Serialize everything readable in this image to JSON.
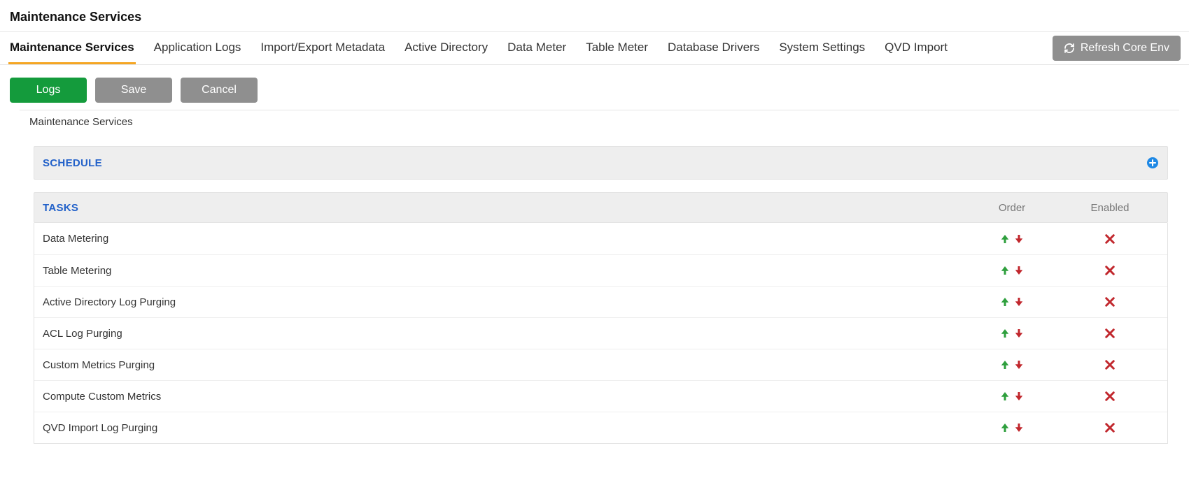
{
  "page": {
    "title": "Maintenance Services",
    "subtitle": "Maintenance Services"
  },
  "tabs": [
    {
      "label": "Maintenance Services",
      "active": true
    },
    {
      "label": "Application Logs",
      "active": false
    },
    {
      "label": "Import/Export Metadata",
      "active": false
    },
    {
      "label": "Active Directory",
      "active": false
    },
    {
      "label": "Data Meter",
      "active": false
    },
    {
      "label": "Table Meter",
      "active": false
    },
    {
      "label": "Database Drivers",
      "active": false
    },
    {
      "label": "System Settings",
      "active": false
    },
    {
      "label": "QVD Import",
      "active": false
    }
  ],
  "buttons": {
    "logs": "Logs",
    "save": "Save",
    "cancel": "Cancel",
    "refresh": "Refresh Core Env"
  },
  "sections": {
    "schedule": {
      "title": "SCHEDULE"
    },
    "tasks": {
      "title": "TASKS",
      "columns": {
        "order": "Order",
        "enabled": "Enabled"
      },
      "rows": [
        {
          "name": "Data Metering",
          "enabled": false
        },
        {
          "name": "Table Metering",
          "enabled": false
        },
        {
          "name": "Active Directory Log Purging",
          "enabled": false
        },
        {
          "name": "ACL Log Purging",
          "enabled": false
        },
        {
          "name": "Custom Metrics Purging",
          "enabled": false
        },
        {
          "name": "Compute Custom Metrics",
          "enabled": false
        },
        {
          "name": "QVD Import Log Purging",
          "enabled": false
        }
      ]
    }
  },
  "colors": {
    "accent_blue": "#2261c9",
    "tab_underline": "#f5a623",
    "btn_green": "#149b3c",
    "btn_grey": "#8f8f8f",
    "arrow_up": "#2e9f3d",
    "arrow_down": "#c1272d",
    "cross": "#c1272d",
    "plus_badge": "#1e88e5"
  }
}
